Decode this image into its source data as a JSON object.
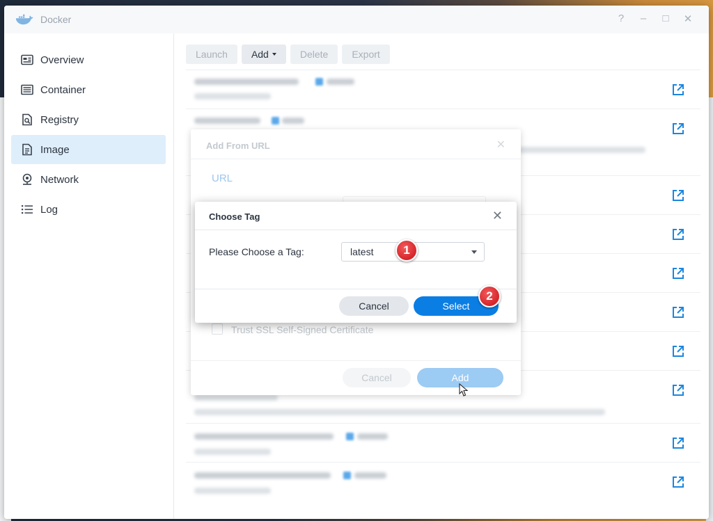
{
  "window": {
    "title": "Docker",
    "help_icon": "?",
    "minimize_icon": "–",
    "maximize_icon": "□",
    "close_icon": "✕"
  },
  "sidebar": {
    "items": [
      {
        "label": "Overview",
        "icon": "overview-icon",
        "active": false
      },
      {
        "label": "Container",
        "icon": "container-icon",
        "active": false
      },
      {
        "label": "Registry",
        "icon": "registry-icon",
        "active": false
      },
      {
        "label": "Image",
        "icon": "image-icon",
        "active": true
      },
      {
        "label": "Network",
        "icon": "network-icon",
        "active": false
      },
      {
        "label": "Log",
        "icon": "log-icon",
        "active": false
      }
    ]
  },
  "toolbar": {
    "launch": "Launch",
    "add": "Add",
    "delete": "Delete",
    "export": "Export"
  },
  "dialog_url": {
    "title": "Add From URL",
    "tab": "URL",
    "trust_label": "Trust SSL Self-Signed Certificate",
    "cancel": "Cancel",
    "add": "Add"
  },
  "dialog_tag": {
    "title": "Choose Tag",
    "prompt": "Please Choose a Tag:",
    "selected_tag": "latest",
    "cancel": "Cancel",
    "select": "Select"
  },
  "annotations": {
    "step1": "1",
    "step2": "2"
  },
  "colors": {
    "accent": "#0b7ee3",
    "badge": "#d6262a",
    "active_nav": "#dfeefb"
  }
}
